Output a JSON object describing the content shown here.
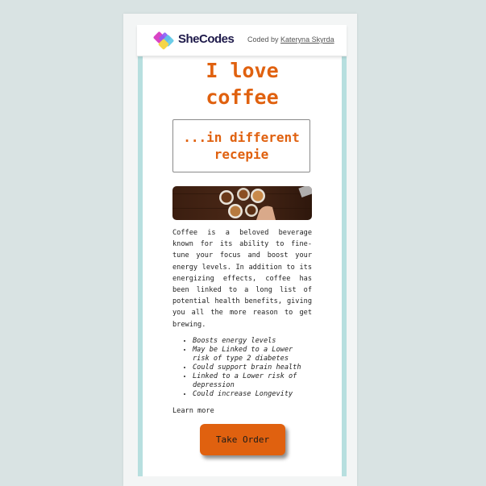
{
  "header": {
    "brand": "SheCodes",
    "coded_by": "Coded by",
    "author": "Kateryna Skyrda"
  },
  "main": {
    "title": "I love coffee",
    "subtitle": "...in different recepie",
    "paragraph": "Coffee is a beloved beverage known for its ability to fine-tune your focus and boost your energy levels. In addition to its energizing effects, coffee has been linked to a long list of potential health benefits, giving you all the more reason to get brewing.",
    "benefits": [
      "Boosts energy levels",
      "May be Linked to a Lower risk of type 2 diabetes",
      "Could support brain health",
      "Linked to a Lower risk of depression",
      "Could increase Longevity"
    ],
    "learn_more": "Learn more",
    "order_button": "Take Order"
  },
  "colors": {
    "accent": "#e0610f",
    "side_border": "#b7dfdf",
    "page_bg": "#d9e3e3"
  }
}
